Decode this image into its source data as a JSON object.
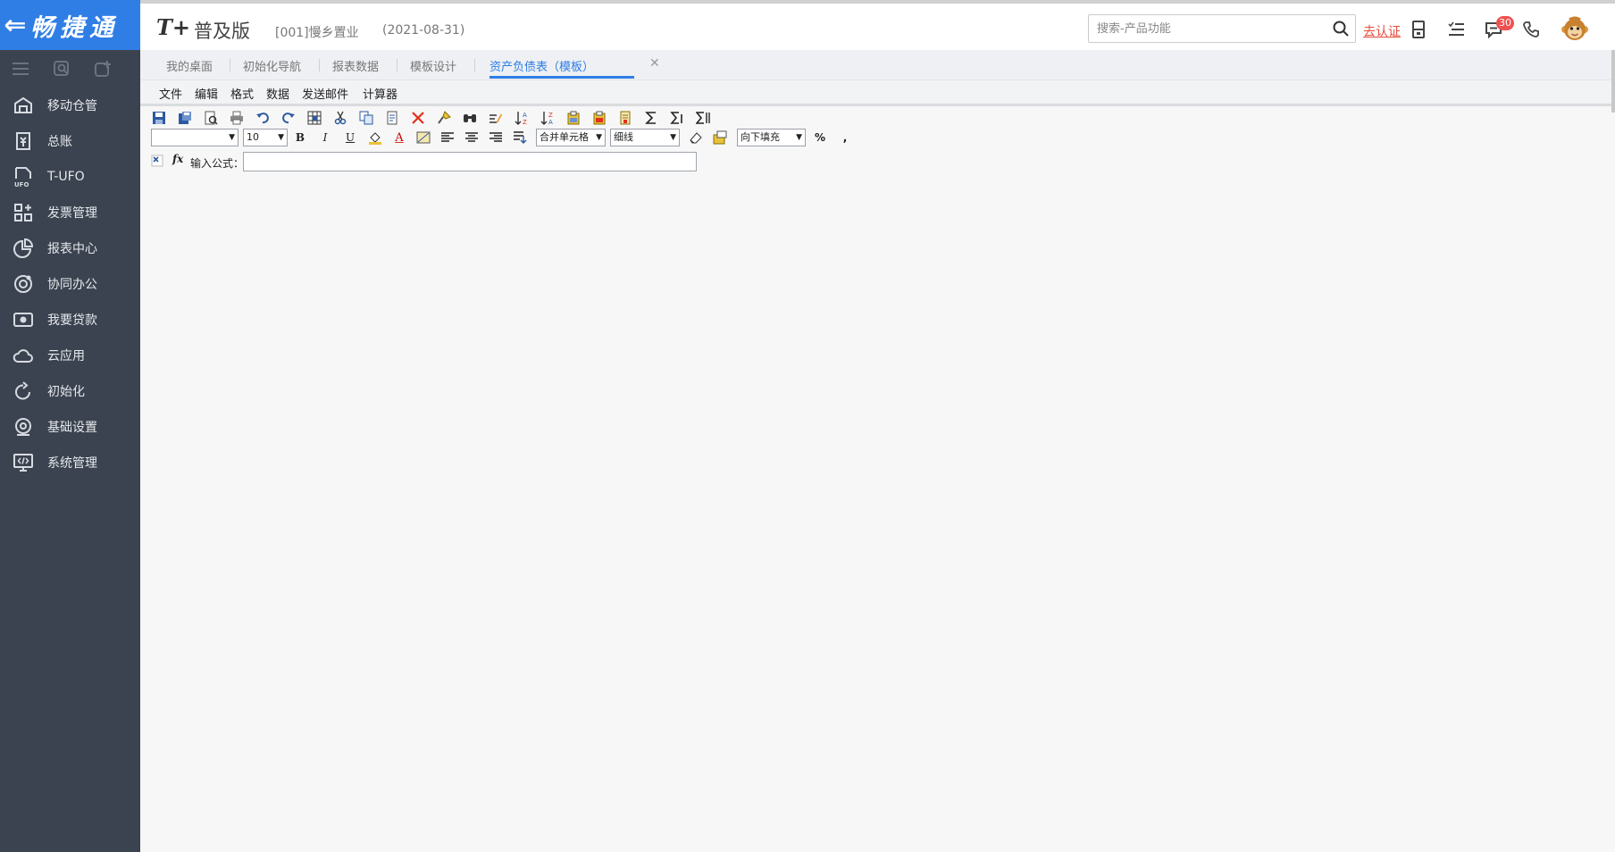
{
  "app": {
    "logo_text": "畅捷通",
    "product_brand": "T+",
    "edition": "普及版",
    "company": "[001]慢乡置业",
    "period": "(2021-08-31)"
  },
  "search": {
    "placeholder": "搜索-产品功能"
  },
  "header": {
    "certify_label": "去认证",
    "notification_count": "30"
  },
  "sidebar": {
    "items": [
      {
        "label": "移动仓管",
        "icon": "warehouse-icon"
      },
      {
        "label": "总账",
        "icon": "ledger-icon"
      },
      {
        "label": "T-UFO",
        "icon": "ufo-file-icon"
      },
      {
        "label": "发票管理",
        "icon": "invoice-grid-icon"
      },
      {
        "label": "报表中心",
        "icon": "pie-chart-icon"
      },
      {
        "label": "协同办公",
        "icon": "collaboration-icon"
      },
      {
        "label": "我要贷款",
        "icon": "money-icon"
      },
      {
        "label": "云应用",
        "icon": "cloud-icon"
      },
      {
        "label": "初始化",
        "icon": "refresh-icon"
      },
      {
        "label": "基础设置",
        "icon": "settings-icon"
      },
      {
        "label": "系统管理",
        "icon": "monitor-code-icon"
      }
    ]
  },
  "tabs": [
    {
      "label": "我的桌面"
    },
    {
      "label": "初始化导航"
    },
    {
      "label": "报表数据"
    },
    {
      "label": "模板设计"
    },
    {
      "label": "资产负债表（模板）",
      "active": true
    }
  ],
  "menu": [
    "文件",
    "编辑",
    "格式",
    "数据",
    "发送邮件",
    "计算器"
  ],
  "format_bar": {
    "font_name": "",
    "font_size": "10",
    "merge_label": "合并单元格",
    "border_label": "细线",
    "fill_label": "向下填充",
    "bold": "B",
    "italic": "I",
    "underline": "U",
    "font_color": "A",
    "percent": "%",
    "comma": ","
  },
  "formula_bar": {
    "label": "输入公式：",
    "fx": "fx",
    "value": ""
  },
  "colors": {
    "sidebar_bg": "#3b4350",
    "logo_bg": "#2f7ee6",
    "accent": "#2f7ee6",
    "certify": "#e74c3c",
    "badge": "#f05050"
  }
}
